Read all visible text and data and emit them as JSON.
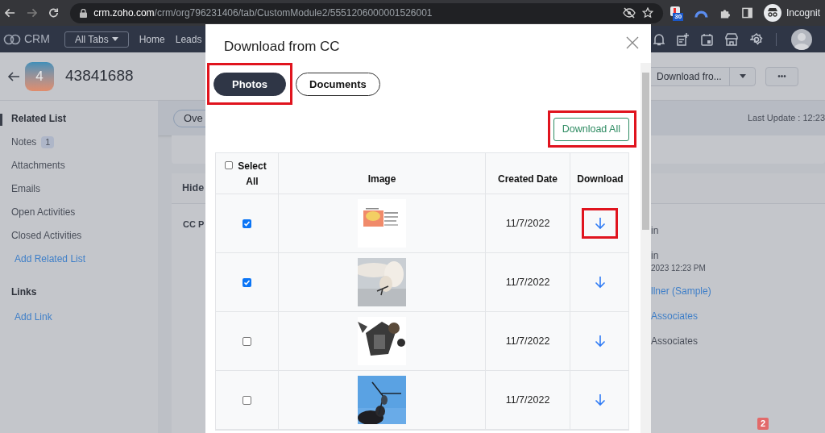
{
  "browser": {
    "url_host": "crm.zoho.com",
    "url_path": "/crm/org796231406/tab/CustomModule2/5551206000001526001",
    "extension_badge": "30",
    "profile_label": "Incognit"
  },
  "app_header": {
    "logo": "CRM",
    "all_tabs": "All Tabs",
    "nav": [
      "Home",
      "Leads"
    ]
  },
  "record": {
    "avatar_letter": "4",
    "title": "43841688",
    "primary_action": "Download fro...",
    "more": "•••"
  },
  "sidebar": {
    "heading": "Related List",
    "items": [
      {
        "label": "Notes",
        "count": "1"
      },
      {
        "label": "Attachments"
      },
      {
        "label": "Emails"
      },
      {
        "label": "Open Activities"
      },
      {
        "label": "Closed Activities"
      }
    ],
    "add_related": "Add Related List",
    "links_heading": "Links",
    "add_link": "Add Link"
  },
  "main": {
    "tab": "Ove",
    "last_update": "Last Update : 12:23",
    "section_title": "Hide",
    "field_label": "CC P",
    "values": [
      {
        "text": "in",
        "kind": "plain"
      },
      {
        "text": "in",
        "kind": "plain"
      },
      {
        "text": "2023 12:23 PM",
        "kind": "sub"
      },
      {
        "text": "llner (Sample)",
        "kind": "link"
      },
      {
        "text": "Associates",
        "kind": "link"
      },
      {
        "text": "Associates",
        "kind": "plain"
      }
    ]
  },
  "notification_badge": "2",
  "dialog": {
    "title": "Download from CC",
    "tabs": [
      {
        "label": "Photos",
        "selected": true,
        "highlighted": true
      },
      {
        "label": "Documents",
        "selected": false,
        "highlighted": false
      }
    ],
    "download_all": {
      "label": "Download All",
      "highlighted": true
    },
    "table": {
      "columns": [
        "Select All",
        "Image",
        "Created Date",
        "Download"
      ],
      "select_all_checked": false,
      "rows": [
        {
          "checked": true,
          "created_date": "11/7/2022",
          "download_highlighted": true
        },
        {
          "checked": true,
          "created_date": "11/7/2022",
          "download_highlighted": false
        },
        {
          "checked": false,
          "created_date": "11/7/2022",
          "download_highlighted": false
        },
        {
          "checked": false,
          "created_date": "11/7/2022",
          "download_highlighted": false
        }
      ]
    }
  }
}
